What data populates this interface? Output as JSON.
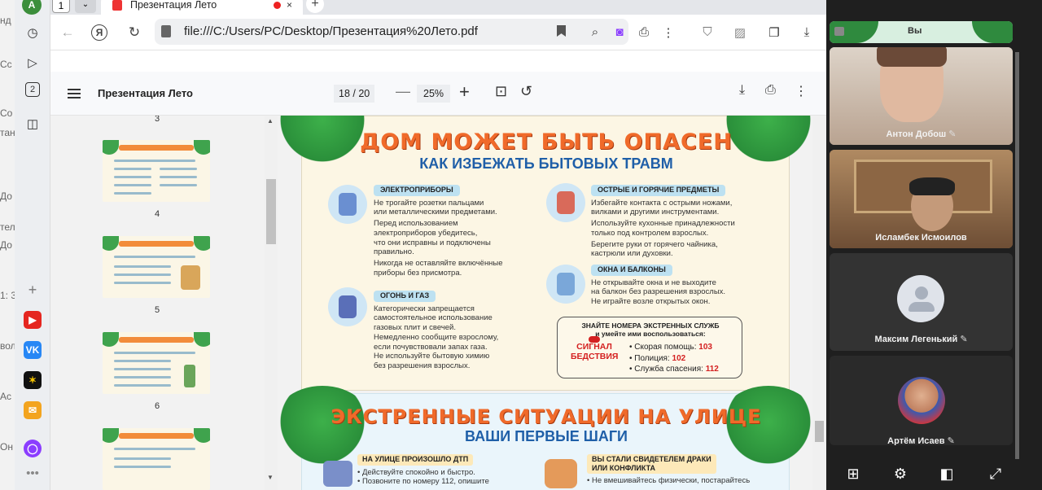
{
  "behind_window_fragments": [
    "нд",
    "Сс",
    "Со",
    "тан",
    "До",
    "тел",
    "До",
    "1: 3",
    "Ас",
    "вол",
    "Он"
  ],
  "yandex_sidebar": {
    "avatar_letter": "А",
    "tab_count": "2"
  },
  "browser": {
    "tab_number": "1",
    "tab_title": "Презентация Лето",
    "url": "file:///C:/Users/PC/Desktop/Презентация%20Лето.pdf",
    "close_symbol": "×",
    "new_tab_symbol": "+"
  },
  "pdf": {
    "title": "Презентация Лето",
    "current_page": "18",
    "page_separator": "/",
    "total_pages": "20",
    "zoom": "25%",
    "thumbnail_numbers": [
      "3",
      "4",
      "5",
      "6"
    ],
    "page18": {
      "title": "ДОМ МОЖЕТ БЫТЬ ОПАСЕН",
      "subtitle": "КАК ИЗБЕЖАТЬ БЫТОВЫХ ТРАВМ",
      "sections": [
        {
          "heading": "ЭЛЕКТРОПРИБОРЫ",
          "lines": [
            "Не трогайте розетки пальцами",
            "или металлическими предметами.",
            "Перед использованием",
            "электроприборов убедитесь,",
            "что они исправны и подключены",
            "правильно.",
            "Никогда не оставляйте включённые",
            "приборы без присмотра."
          ]
        },
        {
          "heading": "ОГОНЬ И ГАЗ",
          "lines": [
            "Категорически запрещается",
            "самостоятельное использование",
            "газовых плит и свечей.",
            "Немедленно сообщите взрослому,",
            "если почувствовали запах газа.",
            "Не используйте бытовую химию",
            "без разрешения взрослых."
          ]
        },
        {
          "heading": "ОСТРЫЕ И ГОРЯЧИЕ ПРЕДМЕТЫ",
          "lines": [
            "Избегайте контакта с острыми ножами,",
            "вилками и другими инструментами.",
            "Используйте кухонные принадлежности",
            "только под контролем взрослых.",
            "Берегите руки от горячего чайника,",
            "кастрюли или духовки."
          ]
        },
        {
          "heading": "ОКНА И БАЛКОНЫ",
          "lines": [
            "Не открывайте окна и не выходите",
            "на балкон без разрешения взрослых.",
            "Не играйте возле открытых окон."
          ]
        }
      ],
      "emergency": {
        "heading_line1": "ЗНАЙТЕ НОМЕРА ЭКСТРЕННЫХ СЛУЖБ",
        "heading_line2": "и умейте ими воспользоваться:",
        "signal_line1": "СИГНАЛ",
        "signal_line2": "БЕДСТВИЯ",
        "services": [
          {
            "label": "• Скорая помощь: ",
            "number": "103"
          },
          {
            "label": "• Полиция: ",
            "number": "102"
          },
          {
            "label": "• Служба спасения: ",
            "number": "112"
          }
        ]
      }
    },
    "page19": {
      "title": "ЭКСТРЕННЫЕ СИТУАЦИИ НА УЛИЦЕ",
      "subtitle": "ВАШИ ПЕРВЫЕ ШАГИ",
      "left_heading": "НА УЛИЦЕ ПРОИЗОШЛО ДТП",
      "left_lines": [
        "• Действуйте спокойно и быстро.",
        "• Позвоните по номеру 112, опишите"
      ],
      "right_heading_line1": "ВЫ СТАЛИ СВИДЕТЕЛЕМ ДРАКИ",
      "right_heading_line2": "ИЛИ КОНФЛИКТА",
      "right_lines": [
        "• Не вмешивайтесь физически, постарайтесь"
      ]
    }
  },
  "meeting": {
    "top_tile_label": "Вы",
    "participants": [
      {
        "name": "Антон Добош"
      },
      {
        "name": "Исламбек Исмоилов"
      },
      {
        "name": "Максим Легенький"
      },
      {
        "name": "Артём Исаев"
      }
    ],
    "mic_off_symbol": "✎"
  }
}
